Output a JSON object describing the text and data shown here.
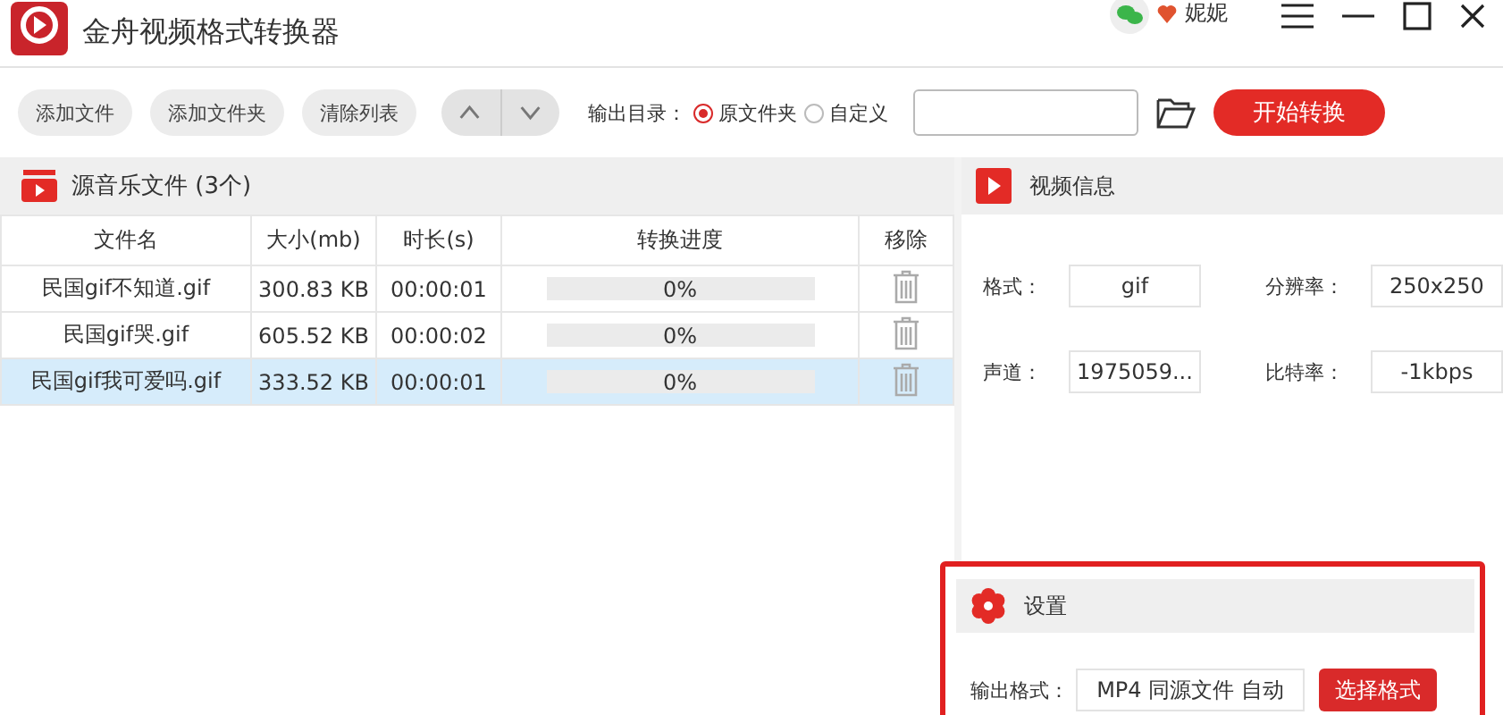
{
  "window": {
    "title": "金舟视频格式转换器",
    "user": "妮妮"
  },
  "toolbar": {
    "buttons": [
      "添加文件",
      "添加文件夹",
      "清除列表"
    ],
    "output_label": "输出目录：",
    "radios": [
      {
        "label": "原文件夹",
        "selected": true
      },
      {
        "label": "自定义",
        "selected": false
      }
    ],
    "start_button": "开始转换"
  },
  "file_list": {
    "title": "源音乐文件 (3个)",
    "columns": [
      "文件名",
      "大小(mb)",
      "时长(s)",
      "转换进度",
      "移除"
    ],
    "rows": [
      {
        "name": "民国gif不知道.gif",
        "size": "300.83 KB",
        "duration": "00:00:01",
        "progress": "0%",
        "selected": false
      },
      {
        "name": "民国gif哭.gif",
        "size": "605.52 KB",
        "duration": "00:00:02",
        "progress": "0%",
        "selected": false
      },
      {
        "name": "民国gif我可爱吗.gif",
        "size": "333.52 KB",
        "duration": "00:00:01",
        "progress": "0%",
        "selected": true
      }
    ]
  },
  "video_info": {
    "title": "视频信息",
    "fields": [
      {
        "label": "格式：",
        "value": "gif"
      },
      {
        "label": "分辨率：",
        "value": "250x250"
      },
      {
        "label": "声道：",
        "value": "1975059..."
      },
      {
        "label": "比特率：",
        "value": "-1kbps"
      }
    ]
  },
  "settings": {
    "title": "设置",
    "output_format_label": "输出格式：",
    "output_format": "MP4 同源文件 自动",
    "choose_button": "选择格式"
  }
}
